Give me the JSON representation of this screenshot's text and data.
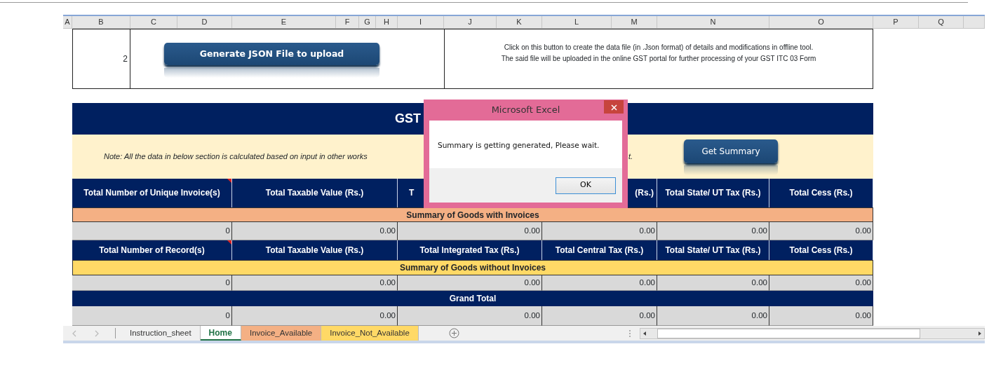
{
  "column_headers": [
    "A",
    "B",
    "C",
    "D",
    "E",
    "F",
    "G",
    "H",
    "I",
    "J",
    "K",
    "L",
    "M",
    "N",
    "O",
    "P",
    "Q"
  ],
  "action_row": {
    "step": "2",
    "button": "Generate JSON File to upload",
    "description": [
      "Click on this button to create the data file (in .Json format) of details and modifications in offline tool.",
      "The said file will be uploaded in the online GST portal for further processing of your GST ITC 03 Form"
    ]
  },
  "summary": {
    "title": "GST",
    "note": [
      "Note: All the data in below section is calculated based on input in other works",
      "t."
    ],
    "get_summary_button": "Get Summary",
    "sections": [
      {
        "headers": [
          {
            "text": "Total Number of Unique Invoice(s)",
            "comment": true,
            "kind": "full"
          },
          {
            "text": "Total Taxable Value (Rs.)",
            "comment": false,
            "kind": "full"
          },
          {
            "text": "T",
            "comment": false,
            "kind": "start"
          },
          {
            "text": "(Rs.)",
            "comment": false,
            "kind": "end"
          },
          {
            "text": "Total State/ UT Tax (Rs.)",
            "comment": false,
            "kind": "full"
          },
          {
            "text": "Total Cess (Rs.)",
            "comment": false,
            "kind": "full"
          }
        ],
        "label": "Summary of Goods with Invoices",
        "color": "#f4b084",
        "values": [
          "0",
          "0.00",
          "0.00",
          "0.00",
          "0.00",
          "0.00"
        ]
      },
      {
        "headers": [
          {
            "text": "Total Number of Record(s)",
            "comment": true,
            "kind": "full"
          },
          {
            "text": "Total Taxable Value (Rs.)",
            "comment": false,
            "kind": "full"
          },
          {
            "text": "Total Integrated Tax (Rs.)",
            "comment": false,
            "kind": "full"
          },
          {
            "text": "Total Central Tax (Rs.)",
            "comment": false,
            "kind": "full"
          },
          {
            "text": "Total State/ UT Tax (Rs.)",
            "comment": false,
            "kind": "full"
          },
          {
            "text": "Total Cess (Rs.)",
            "comment": false,
            "kind": "full"
          }
        ],
        "label": "Summary of Goods without Invoices",
        "color": "#ffd966",
        "values": [
          "0",
          "0.00",
          "0.00",
          "0.00",
          "0.00",
          "0.00"
        ]
      }
    ],
    "grand_total": {
      "label": "Grand Total",
      "values": [
        "0",
        "0.00",
        "0.00",
        "0.00",
        "0.00",
        "0.00"
      ]
    }
  },
  "dialog": {
    "title": "Microsoft Excel",
    "message": "Summary is getting generated, Please wait.",
    "button": "OK"
  },
  "sheet_tabs": [
    {
      "label": "Instruction_sheet",
      "selected": false,
      "color": "#f0f0f0"
    },
    {
      "label": "Home",
      "selected": true,
      "color": "#ffffff"
    },
    {
      "label": "Invoice_Available",
      "selected": false,
      "color": "#f4b084"
    },
    {
      "label": "Invoice_Not_Available",
      "selected": false,
      "color": "#ffd966"
    }
  ]
}
